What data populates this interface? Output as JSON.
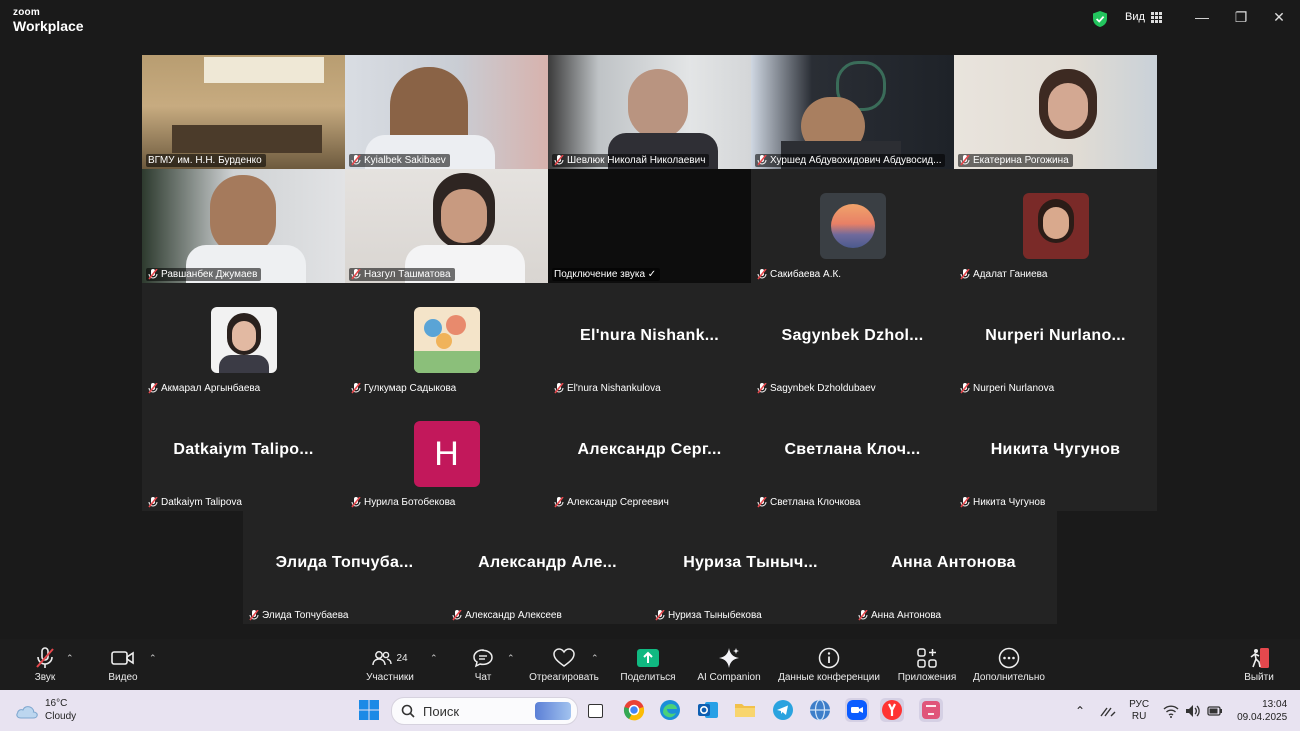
{
  "app": {
    "logo_line1": "zoom",
    "logo_line2": "Workplace",
    "view_label": "Вид",
    "secure_color": "#23c55e"
  },
  "gallery": {
    "row1": [
      {
        "label": "ВГМУ им. Н.Н. Бурденко",
        "muted": false
      },
      {
        "label": "Kyialbek Sakibaev",
        "muted": true
      },
      {
        "label": "Шевлюк Николай Николаевич",
        "muted": true
      },
      {
        "label": "Хуршед Абдувохидович Абдувосид...",
        "muted": true
      },
      {
        "label": "Екатерина Рогожина",
        "muted": true
      }
    ],
    "row2": [
      {
        "label": "Равшанбек Джумаев"
      },
      {
        "label": "Назгул Ташматова"
      },
      {
        "label": "Подключение звука ✓"
      },
      {
        "label": "Сакибаева А.К."
      },
      {
        "label": "Адалат Ганиева"
      }
    ],
    "row3": [
      {
        "label": "Акмарал Аргынбаева"
      },
      {
        "label": "Гулкумар Садыкова"
      },
      {
        "big": "El'nura  Nishank...",
        "label": "El'nura Nishankulova"
      },
      {
        "big": "Sagynbek  Dzhol...",
        "label": "Sagynbek Dzholdubaev"
      },
      {
        "big": "Nurperi  Nurlano...",
        "label": "Nurperi Nurlanova"
      }
    ],
    "row4": [
      {
        "big": "Datkaiym  Talipo...",
        "label": "Datkaiym Talipova"
      },
      {
        "avatar_letter": "H",
        "label": "Нурила Ботобекова"
      },
      {
        "big": "Александр  Серг...",
        "label": "Александр Сергеевич"
      },
      {
        "big": "Светлана  Клоч...",
        "label": "Светлана Клочкова"
      },
      {
        "big": "Никита  Чугунов",
        "label": "Никита Чугунов"
      }
    ],
    "row5": [
      {
        "big": "Элида  Топчуба...",
        "label": "Элида Топчубаева"
      },
      {
        "big": "Александр  Але...",
        "label": "Александр Алексеев"
      },
      {
        "big": "Нуриза  Тыныч...",
        "label": "Нуриза Тыныбекова"
      },
      {
        "big": "Анна  Антонова",
        "label": "Анна Антонова"
      }
    ]
  },
  "toolbar": {
    "audio": "Звук",
    "video": "Видео",
    "participants": "Участники",
    "participants_count": "24",
    "chat": "Чат",
    "react": "Отреагировать",
    "share": "Поделиться",
    "ai": "AI Companion",
    "info": "Данные конференции",
    "apps": "Приложения",
    "more": "Дополнительно",
    "leave": "Выйти",
    "share_color": "#10b981",
    "leave_color": "#e5484d"
  },
  "taskbar": {
    "temp": "16°C",
    "weather": "Cloudy",
    "search_placeholder": "Поиск",
    "lang_1": "РУС",
    "lang_2": "RU",
    "time": "13:04",
    "date": "09.04.2025"
  }
}
